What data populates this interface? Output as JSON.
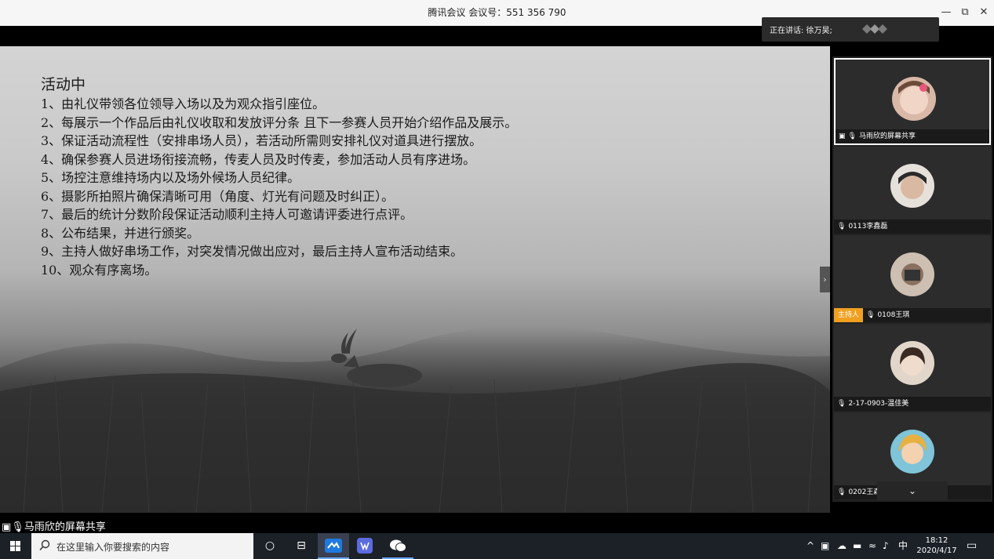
{
  "window": {
    "title": "腾讯会议 会议号：551 356 790",
    "minimize": "—",
    "restore": "⧉",
    "close": "✕"
  },
  "speaking": {
    "label": "正在讲话: 徐万昊;"
  },
  "slide": {
    "heading": "活动中",
    "lines": [
      "1、由礼仪带领各位领导入场以及为观众指引座位。",
      "2、每展示一个作品后由礼仪收取和发放评分条 且下一参赛人员开始介绍作品及展示。",
      "3、保证活动流程性（安排串场人员），若活动所需则安排礼仪对道具进行摆放。",
      "4、确保参赛人员进场衔接流畅，传麦人员及时传麦，参加活动人员有序进场。",
      "5、场控注意维持场内以及场外候场人员纪律。",
      "6、摄影所拍照片确保清晰可用（角度、灯光有问题及时纠正）。",
      "7、最后的统计分数阶段保证活动顺利主持人可邀请评委进行点评。",
      "8、公布结果，并进行颁奖。",
      "9、主持人做好串场工作，对突发情况做出应对，最后主持人宣布活动结束。",
      "10、观众有序离场。"
    ]
  },
  "panel": {
    "expand_icon": "›",
    "collapse_icon": "⌄",
    "host_badge": "主持人",
    "participants": [
      {
        "name": "马雨欣的屏幕共享",
        "color": "#e8c8b8"
      },
      {
        "name": "0113李鑫磊",
        "color": "#d8cfc8"
      },
      {
        "name": "0108王琪",
        "color": "#c9b8a8"
      },
      {
        "name": "2-17-0903-温佳美",
        "color": "#d9cbbd"
      },
      {
        "name": "0202王森洋",
        "color": "#e3c070"
      }
    ]
  },
  "share_label": "马雨欣的屏幕共享",
  "taskbar": {
    "search_placeholder": "在这里输入你要搜索的内容",
    "ime": "中",
    "time": "18:12",
    "date": "2020/4/17",
    "tray_up": "^"
  }
}
